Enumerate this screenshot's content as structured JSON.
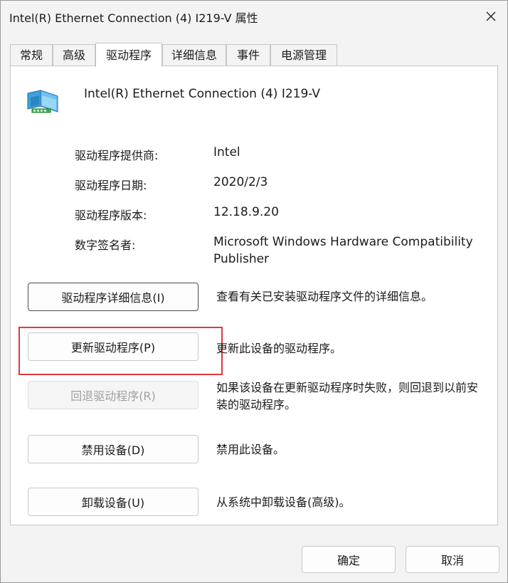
{
  "window": {
    "title": "Intel(R) Ethernet Connection (4) I219-V 属性"
  },
  "tabs": [
    {
      "label": "常规"
    },
    {
      "label": "高级"
    },
    {
      "label": "驱动程序",
      "active": true
    },
    {
      "label": "详细信息"
    },
    {
      "label": "事件"
    },
    {
      "label": "电源管理"
    }
  ],
  "device": {
    "name": "Intel(R) Ethernet Connection (4) I219-V",
    "icon": "network-adapter-icon"
  },
  "properties": [
    {
      "label": "驱动程序提供商:",
      "value": "Intel"
    },
    {
      "label": "驱动程序日期:",
      "value": "2020/2/3"
    },
    {
      "label": "驱动程序版本:",
      "value": "12.18.9.20"
    },
    {
      "label": "数字签名者:",
      "value": "Microsoft Windows Hardware Compatibility Publisher"
    }
  ],
  "actions": [
    {
      "label": "驱动程序详细信息(I)",
      "description": "查看有关已安装驱动程序文件的详细信息。",
      "enabled": true
    },
    {
      "label": "更新驱动程序(P)",
      "description": "更新此设备的驱动程序。",
      "enabled": true
    },
    {
      "label": "回退驱动程序(R)",
      "description": "如果该设备在更新驱动程序时失败，则回退到以前安装的驱动程序。",
      "enabled": false
    },
    {
      "label": "禁用设备(D)",
      "description": "禁用此设备。",
      "enabled": true
    },
    {
      "label": "卸载设备(U)",
      "description": "从系统中卸载设备(高级)。",
      "enabled": true
    }
  ],
  "footer": {
    "ok_label": "确定",
    "cancel_label": "取消"
  },
  "colors": {
    "highlight": "#e0393f",
    "window_bg": "#f3f3f3",
    "panel_bg": "#ffffff"
  }
}
